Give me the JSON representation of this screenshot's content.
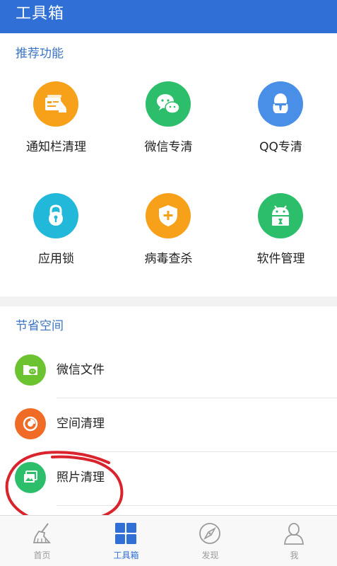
{
  "header": {
    "title": "工具箱"
  },
  "recommended": {
    "label": "推荐功能",
    "items": [
      {
        "label": "通知栏清理",
        "color": "#f7a11a",
        "icon": "notification-clean-icon"
      },
      {
        "label": "微信专清",
        "color": "#2cbe6b",
        "icon": "wechat-icon"
      },
      {
        "label": "QQ专清",
        "color": "#4a8fe7",
        "icon": "qq-icon"
      },
      {
        "label": "应用锁",
        "color": "#22b8da",
        "icon": "lock-icon"
      },
      {
        "label": "病毒查杀",
        "color": "#f7a11a",
        "icon": "shield-icon"
      },
      {
        "label": "软件管理",
        "color": "#2cbe6b",
        "icon": "android-icon"
      }
    ]
  },
  "space": {
    "label": "节省空间",
    "items": [
      {
        "label": "微信文件",
        "color": "#6cc330",
        "icon": "wechat-folder-icon"
      },
      {
        "label": "空间清理",
        "color": "#f06b25",
        "icon": "pie-chart-icon"
      },
      {
        "label": "照片清理",
        "color": "#2cbe6b",
        "icon": "photo-icon"
      }
    ]
  },
  "tabs": [
    {
      "label": "首页",
      "icon": "broom-icon",
      "active": false
    },
    {
      "label": "工具箱",
      "icon": "toolbox-grid-icon",
      "active": true
    },
    {
      "label": "发现",
      "icon": "compass-icon",
      "active": false
    },
    {
      "label": "我",
      "icon": "person-icon",
      "active": false
    }
  ],
  "colors": {
    "accent": "#2f6fd6",
    "annotation": "#d9232d"
  }
}
